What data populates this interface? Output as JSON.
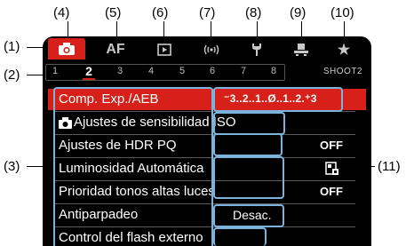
{
  "callouts": {
    "c1": "(1)",
    "c2": "(2)",
    "c3": "(3)",
    "c4": "(4)",
    "c5": "(5)",
    "c6": "(6)",
    "c7": "(7)",
    "c8": "(8)",
    "c9": "(9)",
    "c10": "(10)",
    "c11": "(11)"
  },
  "tabs": [
    {
      "icon": "camera-icon",
      "active": true
    },
    {
      "label": "AF",
      "icon": "af-icon"
    },
    {
      "icon": "playback-icon"
    },
    {
      "icon": "wireless-icon",
      "label": "((ᵲ))"
    },
    {
      "icon": "wrench-icon"
    },
    {
      "icon": "custom-functions-icon"
    },
    {
      "icon": "star-icon",
      "label": "★"
    }
  ],
  "pages": [
    "1",
    "2",
    "3",
    "4",
    "5",
    "6",
    "7",
    "8"
  ],
  "active_page": "2",
  "section_label": "SHOOT2",
  "menu": [
    {
      "label": "Comp. Exp./AEB",
      "value": "⁻3..2..1..Ø..1..2.⁺3",
      "selected": true
    },
    {
      "label": "Ajustes de sensibilidad ISO",
      "value": ""
    },
    {
      "label": "Ajustes de HDR PQ",
      "value": "OFF"
    },
    {
      "label": "Luminosidad Automática",
      "value": ""
    },
    {
      "label": "Prioridad tonos altas luces",
      "value": "OFF"
    },
    {
      "label": "Antiparpadeo",
      "value": "Desac."
    },
    {
      "label": "Control del flash externo",
      "value": ""
    }
  ],
  "colors": {
    "accent": "#d8201a",
    "highlight_box": "#7ab4dc",
    "screen": "#000000"
  }
}
